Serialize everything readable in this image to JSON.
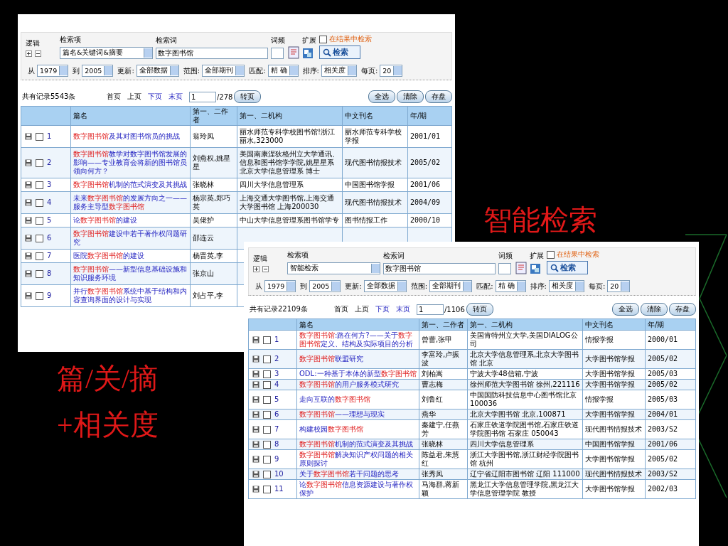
{
  "captions": [
    {
      "text": "智能检索"
    },
    {
      "text": "篇/关/摘"
    },
    {
      "text": "+相关度"
    }
  ],
  "panels": [
    {
      "search": {
        "logic_label": "逻辑",
        "field_label": "检索项",
        "term_label": "检索词",
        "freq_label": "词频",
        "expand_label": "扩展",
        "within": {
          "label": "在结果中检索",
          "checked": false
        },
        "field": "篇名&关键词&摘要",
        "term": "数字图书馆",
        "button": "检索",
        "filters": [
          {
            "label": "从",
            "value": "1979"
          },
          {
            "label": "到",
            "value": "2005"
          },
          {
            "label": "更新:",
            "value": "全部数据"
          },
          {
            "label": "范围:",
            "value": "全部期刊"
          },
          {
            "label": "匹配:",
            "value": "精 确"
          },
          {
            "label": "排序:",
            "value": "相关度"
          },
          {
            "label": "每页:",
            "value": "20"
          }
        ]
      },
      "pager": {
        "total": "共有记录5543条",
        "first": "首页",
        "prev": "上页",
        "next": "下页",
        "last": "末页",
        "page": "1",
        "pages": "/278",
        "go": "转页",
        "actions": [
          "全选",
          "清除",
          "存盘"
        ]
      },
      "table": {
        "columns": [
          "篇名",
          "第一、二作者",
          "第一、二机构",
          "中文刊名",
          "年/期"
        ],
        "rows": [
          {
            "no": "1",
            "checked": false,
            "title": [
              {
                "text": "数字图书馆",
                "highlight": true
              },
              {
                "text": "及其对图书馆员的挑战",
                "highlight": false
              }
            ],
            "author": "翁玲凤",
            "org": "丽水师范专科学校图书馆!浙江丽水,323000",
            "journal": "丽水师范专科学校学报",
            "year": "2001/01"
          },
          {
            "no": "2",
            "checked": false,
            "title": [
              {
                "text": "数字图书馆",
                "highlight": true
              },
              {
                "text": "教学对数字图书馆发展的影响——专业教育会将新的图书馆员领向何方？",
                "highlight": false
              }
            ],
            "author": "刘燕权,姚星星",
            "org": "美国南康涅狄格州立大学通讯、信息和图书馆学学院,姚星星系北京大学信息管理系 博士",
            "journal": "现代图书情报技术",
            "year": "2005/02"
          },
          {
            "no": "3",
            "checked": false,
            "title": [
              {
                "text": "数字图书馆",
                "highlight": true
              },
              {
                "text": "机制的范式演变及其挑战",
                "highlight": false
              }
            ],
            "author": "张晓林",
            "org": "四川大学信息管理系",
            "journal": "中国图书馆学报",
            "year": "2001/06"
          },
          {
            "no": "4",
            "checked": false,
            "title": [
              {
                "text": "未来",
                "highlight": false
              },
              {
                "text": "数字图书馆",
                "highlight": true
              },
              {
                "text": "的发展方向之一——服务主导型",
                "highlight": false
              },
              {
                "text": "数字图书馆",
                "highlight": true
              }
            ],
            "author": "杨宗英,郑巧英",
            "org": "上海交通大学图书馆,上海交通大学图书馆 上海200030",
            "journal": "现代图书情报技术",
            "year": "2004/09"
          },
          {
            "no": "5",
            "checked": false,
            "title": [
              {
                "text": "论",
                "highlight": false
              },
              {
                "text": "数字图书馆",
                "highlight": true
              },
              {
                "text": "的建设",
                "highlight": false
              }
            ],
            "author": "吴佬护",
            "org": "中山大学信息管理系图书馆学专",
            "journal": "图书情报工作",
            "year": "2000/10"
          },
          {
            "no": "6",
            "checked": false,
            "title": [
              {
                "text": "数字图书馆",
                "highlight": true
              },
              {
                "text": "建设中若干著作权问题研究",
                "highlight": false
              }
            ],
            "author": "邵连云"
          },
          {
            "no": "7",
            "checked": false,
            "title": [
              {
                "text": "医院",
                "highlight": false
              },
              {
                "text": "数字图书馆",
                "highlight": true
              },
              {
                "text": "的建设",
                "highlight": false
              }
            ],
            "author": "杨晋英,李"
          },
          {
            "no": "8",
            "checked": false,
            "title": [
              {
                "text": "数字图书馆",
                "highlight": true
              },
              {
                "text": "——新型信息基础设施和知识服务环境",
                "highlight": false
              }
            ],
            "author": "张京山"
          },
          {
            "no": "9",
            "checked": false,
            "title": [
              {
                "text": "并行",
                "highlight": false
              },
              {
                "text": "数字图书馆",
                "highlight": true
              },
              {
                "text": "系统中基于结构和内容查询界面的设计与实现",
                "highlight": false
              }
            ],
            "author": "刘占平,李"
          }
        ]
      }
    },
    {
      "search": {
        "logic_label": "逻辑",
        "field_label": "检索项",
        "term_label": "检索词",
        "freq_label": "词频",
        "expand_label": "扩展",
        "within": {
          "label": "在结果中检索",
          "checked": false
        },
        "field": "智能检索",
        "term": "数字图书馆",
        "button": "检索",
        "filters": [
          {
            "label": "从",
            "value": "1979"
          },
          {
            "label": "到",
            "value": "2005"
          },
          {
            "label": "更新:",
            "value": "全部数据"
          },
          {
            "label": "范围:",
            "value": "全部期刊"
          },
          {
            "label": "匹配:",
            "value": "精 确"
          },
          {
            "label": "排序:",
            "value": "相关度"
          },
          {
            "label": "每页:",
            "value": "20"
          }
        ]
      },
      "pager": {
        "total": "共有记录22109条",
        "first": "首页",
        "prev": "上页",
        "next": "下页",
        "last": "末页",
        "page": "1",
        "pages": "/1106",
        "go": "转页",
        "actions": [
          "全选",
          "清除",
          "存盘"
        ]
      },
      "table": {
        "columns": [
          "篇名",
          "第一、二作者",
          "第一、二机构",
          "中文刊名",
          "年/期"
        ],
        "rows": [
          {
            "no": "1",
            "checked": false,
            "title": [
              {
                "text": "数字图书馆",
                "highlight": true
              },
              {
                "text": ":路在何方?——关于",
                "highlight": false
              },
              {
                "text": "数字图书馆",
                "highlight": true
              },
              {
                "text": "定义、结构及实际项目的分析",
                "highlight": false
              }
            ],
            "author": "曾蕾,张甲",
            "org": "美国肯特州立大学,美国DIALOG公司",
            "journal": "情报学报",
            "year": "2000/01"
          },
          {
            "no": "2",
            "checked": false,
            "title": [
              {
                "text": "数字图书馆",
                "highlight": true
              },
              {
                "text": "联盟研究",
                "highlight": false
              }
            ],
            "author": "李富玲,卢振波",
            "org": "北京大学信息管理系,北京大学图书馆 北京",
            "journal": "大学图书馆学报",
            "year": "2005/02"
          },
          {
            "no": "3",
            "checked": false,
            "title": [
              {
                "text": "ODL:一种基于本体的新型",
                "highlight": false
              },
              {
                "text": "数字图书馆",
                "highlight": true
              }
            ],
            "author": "刘柏嵩",
            "org": "宁波大学48信箱,宁波",
            "journal": "大学图书馆学报",
            "year": "2005/03"
          },
          {
            "no": "4",
            "checked": false,
            "title": [
              {
                "text": "数字图书馆",
                "highlight": true
              },
              {
                "text": "的用户服务模式研究",
                "highlight": false
              }
            ],
            "author": "曹志梅",
            "org": "徐州师范大学图书馆 徐州,221116",
            "journal": "大学图书馆学报",
            "year": "2005/02"
          },
          {
            "no": "5",
            "checked": false,
            "title": [
              {
                "text": "走向互联的",
                "highlight": false
              },
              {
                "text": "数字图书馆",
                "highlight": true
              }
            ],
            "author": "刘鲁红",
            "org": "中国国防科技信息中心图书馆北京100036",
            "journal": "情报学报",
            "year": "2005/03"
          },
          {
            "no": "6",
            "checked": false,
            "title": [
              {
                "text": "数字图书馆",
                "highlight": true
              },
              {
                "text": "——理想与现实",
                "highlight": false
              }
            ],
            "author": "燕华",
            "org": "北京大学图书馆 北京,100871",
            "journal": "大学图书馆学报",
            "year": "2004/01"
          },
          {
            "no": "7",
            "checked": false,
            "title": [
              {
                "text": "构建校园",
                "highlight": false
              },
              {
                "text": "数字图书馆",
                "highlight": true
              }
            ],
            "author": "秦建宁,任燕芳",
            "org": "石家庄铁道学院图书馆,石家庄铁道学院图书馆 石家庄 050043",
            "journal": "现代图书情报技术",
            "year": "2003/S2"
          },
          {
            "no": "8",
            "checked": false,
            "title": [
              {
                "text": "数字图书馆",
                "highlight": true
              },
              {
                "text": "机制的范式演变及其挑战",
                "highlight": false
              }
            ],
            "author": "张晓林",
            "org": "四川大学信息管理系",
            "journal": "中国图书馆学报",
            "year": "2001/06"
          },
          {
            "no": "9",
            "checked": false,
            "title": [
              {
                "text": "数字图书馆",
                "highlight": true
              },
              {
                "text": "解决知识产权问题的相关原则探讨",
                "highlight": false
              }
            ],
            "author": "陈益君,朱慧红",
            "org": "浙江大学图书馆,浙江财经学院图书馆 杭州",
            "journal": "大学图书馆学报",
            "year": "2005/02"
          },
          {
            "no": "10",
            "checked": false,
            "title": [
              {
                "text": "关于",
                "highlight": false
              },
              {
                "text": "数字图书馆",
                "highlight": true
              },
              {
                "text": "若干问题的思考",
                "highlight": false
              }
            ],
            "author": "张秀凤",
            "org": "辽宁省辽阳市图书馆 辽阳 111000",
            "journal": "现代图书情报技术",
            "year": "2003/S2"
          },
          {
            "no": "11",
            "checked": false,
            "title": [
              {
                "text": "论",
                "highlight": false
              },
              {
                "text": "数字图书馆",
                "highlight": true
              },
              {
                "text": "信息资源建设与著作权保护",
                "highlight": false
              }
            ],
            "author": "马海群,蒋新颖",
            "org": "黑龙江大学信息管理学院,黑龙江大学信息管理学院 教授",
            "journal": "大学图书馆学报",
            "year": "2002/03"
          }
        ]
      }
    }
  ]
}
